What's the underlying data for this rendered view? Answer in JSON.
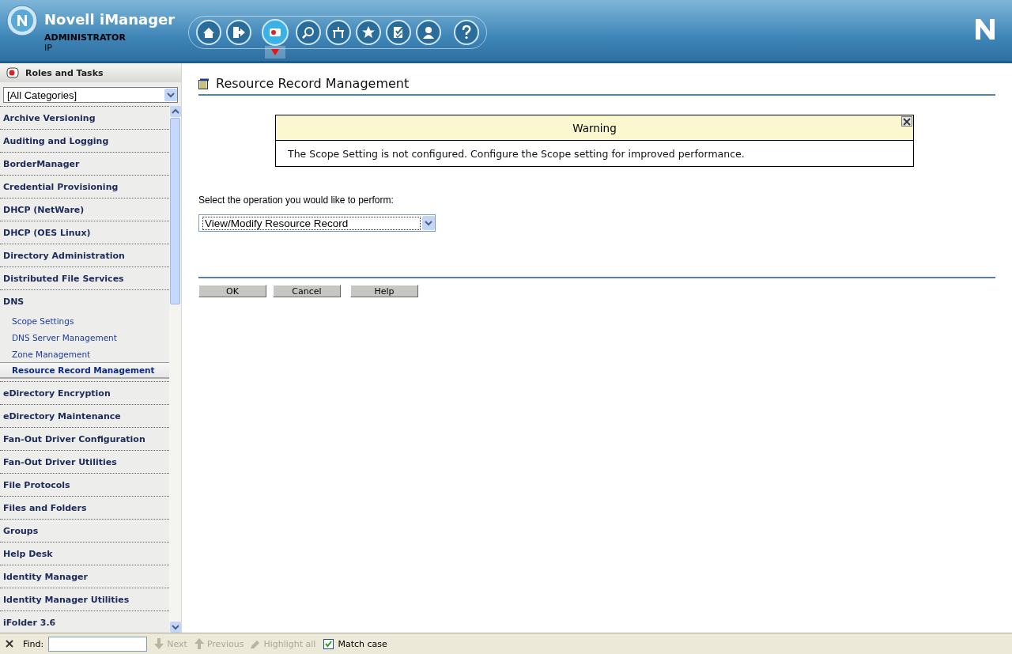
{
  "header": {
    "title": "Novell iManager",
    "user": "ADMINISTRATOR",
    "server": "IP"
  },
  "toolbar": {
    "buttons": [
      {
        "kind": "home",
        "selected": false
      },
      {
        "kind": "exit",
        "selected": false
      },
      {
        "kind": "roles",
        "selected": true
      },
      {
        "kind": "view-objects",
        "selected": false
      },
      {
        "kind": "configure",
        "selected": false
      },
      {
        "kind": "favorites",
        "selected": false
      },
      {
        "kind": "tasks",
        "selected": false
      },
      {
        "kind": "user",
        "selected": false
      },
      {
        "kind": "help",
        "selected": false
      }
    ]
  },
  "sidebar": {
    "title": "Roles and Tasks",
    "category_filter": "[All Categories]",
    "items": [
      {
        "label": "Archive Versioning"
      },
      {
        "label": "Auditing and Logging"
      },
      {
        "label": "BorderManager"
      },
      {
        "label": "Credential Provisioning"
      },
      {
        "label": "DHCP (NetWare)"
      },
      {
        "label": "DHCP (OES Linux)"
      },
      {
        "label": "Directory Administration"
      },
      {
        "label": "Distributed File Services"
      },
      {
        "label": "DNS",
        "children": [
          {
            "label": "Scope Settings",
            "selected": false
          },
          {
            "label": "DNS Server Management",
            "selected": false
          },
          {
            "label": "Zone Management",
            "selected": false
          },
          {
            "label": "Resource Record Management",
            "selected": true
          }
        ]
      },
      {
        "label": "eDirectory Encryption"
      },
      {
        "label": "eDirectory Maintenance"
      },
      {
        "label": "Fan-Out Driver Configuration"
      },
      {
        "label": "Fan-Out Driver Utilities"
      },
      {
        "label": "File Protocols"
      },
      {
        "label": "Files and Folders"
      },
      {
        "label": "Groups"
      },
      {
        "label": "Help Desk"
      },
      {
        "label": "Identity Manager"
      },
      {
        "label": "Identity Manager Utilities"
      },
      {
        "label": "iFolder 3.6"
      }
    ]
  },
  "main": {
    "title": "Resource Record Management",
    "warning": {
      "title": "Warning",
      "message": "The Scope Setting is not configured. Configure the Scope setting for improved performance."
    },
    "operation_label": "Select the operation you would like to perform:",
    "operation": "View/Modify Resource Record",
    "buttons": [
      "OK",
      "Cancel",
      "Help"
    ]
  },
  "find_bar": {
    "label": "Find:",
    "buttons": [
      {
        "kind": "next",
        "label": "Next",
        "disabled": true
      },
      {
        "kind": "previous",
        "label": "Previous",
        "disabled": true
      },
      {
        "kind": "highlight",
        "label": "Highlight all",
        "disabled": true
      }
    ],
    "match_case": {
      "label": "Match case",
      "checked": true
    }
  }
}
